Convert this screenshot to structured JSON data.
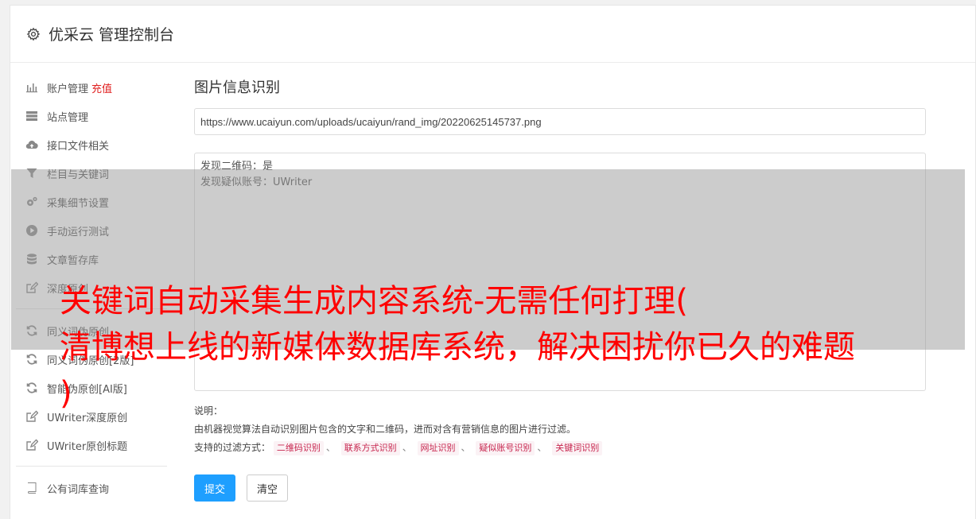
{
  "header": {
    "title": "优采云 管理控制台",
    "icon": "gear-icon"
  },
  "sidebar": {
    "items": [
      {
        "label": "账户管理",
        "badge": "充值",
        "icon": "bar-chart-icon"
      },
      {
        "label": "站点管理",
        "icon": "server-icon"
      },
      {
        "label": "接口文件相关",
        "icon": "cloud-upload-icon"
      },
      {
        "label": "栏目与关键词",
        "icon": "filter-icon"
      },
      {
        "label": "采集细节设置",
        "icon": "cogs-icon"
      },
      {
        "label": "手动运行测试",
        "icon": "play-circle-icon"
      },
      {
        "label": "文章暂存库",
        "icon": "database-icon"
      },
      {
        "label": "深度原创",
        "icon": "edit-icon"
      },
      {
        "label": "同义词伪原创",
        "icon": "refresh-icon"
      },
      {
        "label": "同义词伪原创[2版]",
        "icon": "refresh-icon"
      },
      {
        "label": "智能伪原创[AI版]",
        "icon": "refresh-icon"
      },
      {
        "label": "UWriter深度原创",
        "icon": "edit-icon"
      },
      {
        "label": "UWriter原创标题",
        "icon": "edit-icon"
      },
      {
        "label": "公有词库查询",
        "icon": "book-icon"
      }
    ]
  },
  "main": {
    "title": "图片信息识别",
    "url_value": "https://www.ucaiyun.com/uploads/ucaiyun/rand_img/20220625145737.png",
    "result_lines": [
      "发现二维码：是",
      "发现疑似账号：UWriter"
    ],
    "desc_title": "说明：",
    "desc_text": "由机器视觉算法自动识别图片包含的文字和二维码，进而对含有营销信息的图片进行过滤。",
    "filter_label": "支持的过滤方式：",
    "filter_tags": [
      "二维码识别",
      "联系方式识别",
      "网址识别",
      "疑似账号识别",
      "关键词识别"
    ],
    "filter_separator": "、",
    "submit_label": "提交",
    "clear_label": "清空"
  },
  "overlay": {
    "lines": [
      "关键词自动采集生成内容系统-无需任何打理(",
      "清博想上线的新媒体数据库系统，解决困扰你已久的难题",
      ")"
    ]
  }
}
